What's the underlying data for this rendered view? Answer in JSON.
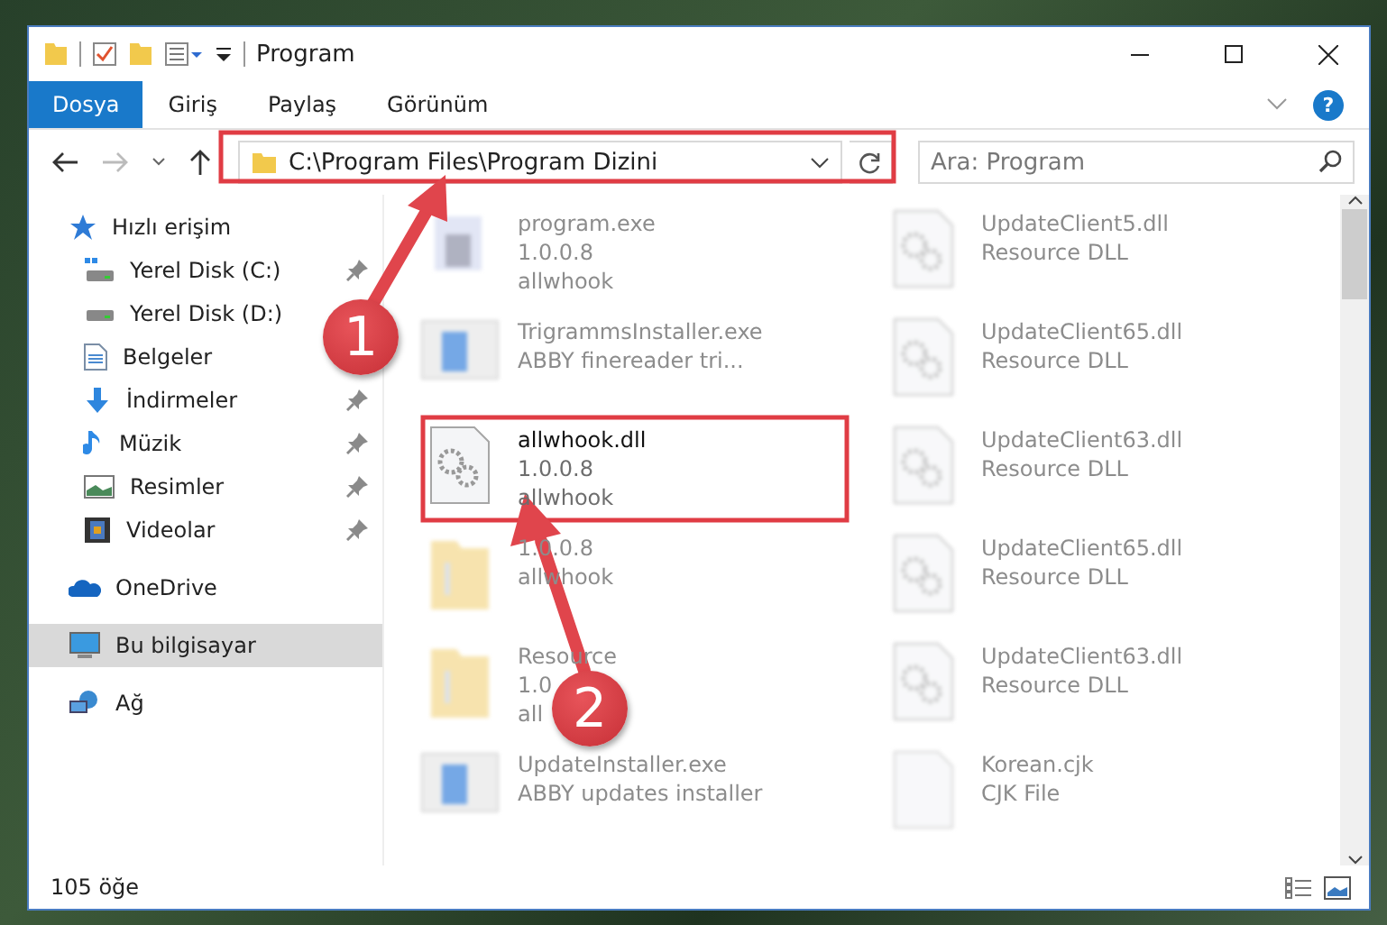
{
  "window": {
    "title": "Program"
  },
  "ribbon": {
    "tabs": [
      {
        "label": "Dosya",
        "selected": true
      },
      {
        "label": "Giriş",
        "selected": false
      },
      {
        "label": "Paylaş",
        "selected": false
      },
      {
        "label": "Görünüm",
        "selected": false
      }
    ],
    "help": "?"
  },
  "address": {
    "path": "C:\\Program Files\\Program Dizini"
  },
  "search": {
    "placeholder": "Ara: Program"
  },
  "sidebar": {
    "items": [
      {
        "label": "Hızlı erişim",
        "kind": "star",
        "selected": false,
        "children": [
          {
            "label": "Yerel Disk (C:)",
            "kind": "system-drive",
            "pinned": true,
            "selected": false
          },
          {
            "label": "Yerel Disk (D:)",
            "kind": "drive",
            "selected": false
          },
          {
            "label": "Belgeler",
            "kind": "document",
            "selected": false
          },
          {
            "label": "İndirmeler",
            "kind": "download",
            "pinned": true,
            "selected": false
          },
          {
            "label": "Müzik",
            "kind": "music",
            "pinned": true,
            "selected": false
          },
          {
            "label": "Resimler",
            "kind": "picture",
            "pinned": true,
            "selected": false
          },
          {
            "label": "Videolar",
            "kind": "video",
            "pinned": true,
            "selected": false
          }
        ]
      },
      {
        "label": "OneDrive",
        "kind": "cloud",
        "selected": false
      },
      {
        "label": "Bu bilgisayar",
        "kind": "computer",
        "selected": true
      },
      {
        "label": "Ağ",
        "kind": "network",
        "selected": false
      }
    ]
  },
  "files": {
    "columns": [
      [
        {
          "kind": "exe",
          "name": "program.exe",
          "lines": [
            "1.0.0.8",
            "allwhook"
          ],
          "blurred": true
        },
        {
          "kind": "installer",
          "name": "TrigrammsInstaller.exe",
          "lines": [
            "ABBY finereader tri..."
          ],
          "blurred": true
        },
        {
          "kind": "dll",
          "name": "allwhook.dll",
          "lines": [
            "1.0.0.8",
            "allwhook"
          ],
          "blurred": false
        },
        {
          "kind": "folder",
          "lines": [
            "1.0.0.8",
            "allwhook"
          ],
          "blurred": true
        },
        {
          "kind": "folder",
          "name": "Resource",
          "lines": [
            "1.0",
            "all"
          ],
          "blurred": true
        },
        {
          "kind": "installer",
          "name": "UpdateInstaller.exe",
          "lines": [
            "ABBY updates installer"
          ],
          "blurred": true
        }
      ],
      [
        {
          "kind": "dll",
          "name": "UpdateClient5.dll",
          "lines": [
            "Resource DLL"
          ],
          "blurred": true
        },
        {
          "kind": "dll",
          "name": "UpdateClient65.dll",
          "lines": [
            "Resource DLL"
          ],
          "blurred": true
        },
        {
          "kind": "dll",
          "name": "UpdateClient63.dll",
          "lines": [
            "Resource DLL"
          ],
          "blurred": true
        },
        {
          "kind": "dll",
          "name": "UpdateClient65.dll",
          "lines": [
            "Resource DLL"
          ],
          "blurred": true
        },
        {
          "kind": "dll",
          "name": "UpdateClient63.dll",
          "lines": [
            "Resource DLL"
          ],
          "blurred": true
        },
        {
          "kind": "file",
          "name": "Korean.cjk",
          "lines": [
            "CJK File"
          ],
          "blurred": true
        }
      ]
    ]
  },
  "status_bar": {
    "count": "105 öğe"
  },
  "annotations": [
    {
      "number": "1"
    },
    {
      "number": "2"
    }
  ]
}
